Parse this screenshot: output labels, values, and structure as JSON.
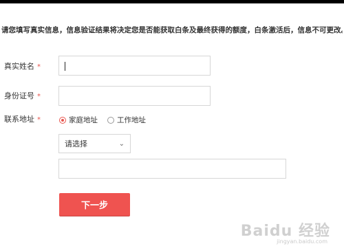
{
  "notice": "请您填写真实信息，信息验证结果将决定您是否能获取白条及最终获得的额度，白条激活后，信息不可更改。",
  "form": {
    "name_label": "真实姓名",
    "id_label": "身份证号",
    "address_label": "联系地址",
    "required_mark": "*",
    "name_value": "",
    "id_value": "",
    "address_type_options": [
      "家庭地址",
      "工作地址"
    ],
    "address_type_selected": "家庭地址",
    "region_select": "请选择",
    "address_detail_value": "",
    "submit_label": "下一步"
  },
  "watermark": {
    "text": "Baidu 经验",
    "sub": "jingyan.baidu.com"
  },
  "colors": {
    "accent": "#ef5350",
    "border": "#d6d6d6"
  }
}
